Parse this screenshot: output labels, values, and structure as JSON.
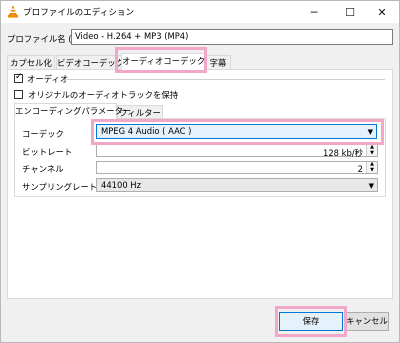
{
  "window": {
    "title": "プロファイルのエディション"
  },
  "profile": {
    "label": "プロファイル名 (N)",
    "value": "Video - H.264 + MP3 (MP4)"
  },
  "tabs": [
    "カプセル化",
    "ビデオコーデック",
    "オーディオコーデック",
    "字幕"
  ],
  "audio_section": {
    "label": "オーディオ",
    "checked": true
  },
  "keep_original": {
    "label": "オリジナルのオーディオトラックを保持",
    "checked": false
  },
  "sub_tabs": [
    "エンコーディングパラメーター",
    "フィルター"
  ],
  "fields": {
    "codec": {
      "label": "コーデック",
      "value": "MPEG 4 Audio ( AAC )"
    },
    "bitrate": {
      "label": "ビットレート",
      "value": "128 kb/秒"
    },
    "channels": {
      "label": "チャンネル",
      "value": "2"
    },
    "samplerate": {
      "label": "サンプリングレート (m)",
      "value": "44100 Hz"
    }
  },
  "buttons": {
    "save": "保存",
    "cancel": "キャンセル"
  },
  "colors": {
    "highlight": "#f2a7c8",
    "accent": "#0078d7"
  }
}
